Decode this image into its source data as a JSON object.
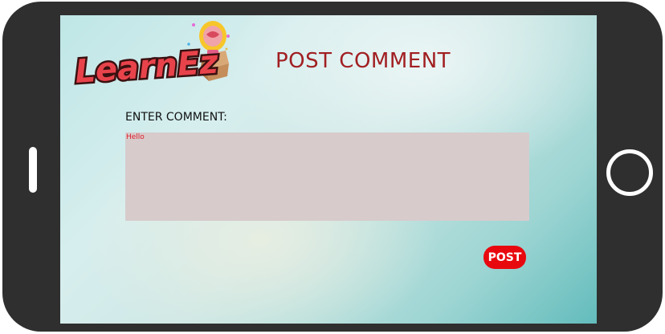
{
  "app": {
    "logo_text": "LearnEz"
  },
  "header": {
    "title": "POST COMMENT"
  },
  "form": {
    "comment_label": "ENTER COMMENT:",
    "comment_value": "Hello",
    "post_label": "POST"
  },
  "colors": {
    "title": "#a11f22",
    "post_button": "#e8090f",
    "comment_box_bg": "#d7cbcc",
    "comment_text": "#e0202b",
    "device_frame": "#2f2f2f",
    "logo_fill": "#e8434b"
  },
  "icons": {
    "logo": "lightbulb-box-logo-icon",
    "home": "home-button-icon",
    "speaker": "speaker-slot-icon"
  }
}
